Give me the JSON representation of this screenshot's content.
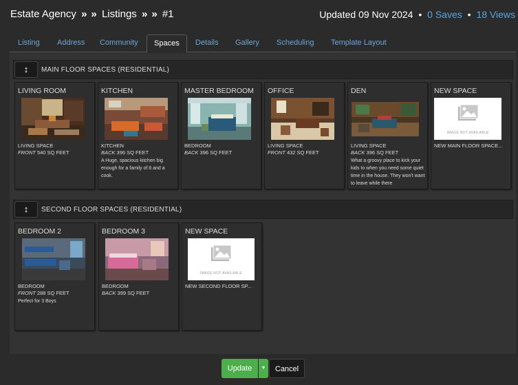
{
  "header": {
    "crumbs": [
      "Estate Agency",
      "Listings",
      "#1"
    ],
    "sep": "»",
    "updated": "Updated 09 Nov 2024",
    "saves": "0 Saves",
    "views": "18 Views",
    "dot": "•"
  },
  "tabs": [
    {
      "label": "Listing"
    },
    {
      "label": "Address"
    },
    {
      "label": "Community"
    },
    {
      "label": "Spaces",
      "active": true
    },
    {
      "label": "Details"
    },
    {
      "label": "Gallery"
    },
    {
      "label": "Scheduling"
    },
    {
      "label": "Template Layout"
    }
  ],
  "sections": [
    {
      "title": "MAIN FLOOR SPACES (RESIDENTIAL)",
      "toggle_icon": "↕",
      "cards": [
        {
          "title": "LIVING ROOM",
          "type": "LIVING SPACE",
          "position": "FRONT",
          "size": "540 SQ FEET",
          "desc": "",
          "image": "living-room"
        },
        {
          "title": "KITCHEN",
          "type": "KITCHEN",
          "position": "BACK",
          "size": "396 SQ FEET",
          "desc": "A Huge, spacious kitchen big enough for a family of 8 and a cook.",
          "image": "kitchen"
        },
        {
          "title": "MASTER BEDROOM",
          "type": "BEDROOM",
          "position": "BACK",
          "size": "396 SQ FEET",
          "desc": "",
          "image": "master-bedroom"
        },
        {
          "title": "OFFICE",
          "type": "LIVING SPACE",
          "position": "FRONT",
          "size": "432 SQ FEET",
          "desc": "",
          "image": "office"
        },
        {
          "title": "DEN",
          "type": "LIVING SPACE",
          "position": "BACK",
          "size": "396 SQ FEET",
          "desc": "What a groovy place to kick your kids to when you need some quiet time in the house. They won't want to leave while there",
          "image": "den"
        }
      ],
      "new_space": {
        "title": "NEW SPACE",
        "label": "NEW MAIN FLOOR SPACE...",
        "na_text": "IMAGE NOT AVAILABLE"
      }
    },
    {
      "title": "SECOND FLOOR SPACES (RESIDENTIAL)",
      "toggle_icon": "↕",
      "cards": [
        {
          "title": "BEDROOM 2",
          "type": "BEDROOM",
          "position": "FRONT",
          "size": "288 SQ FEET",
          "desc": "Perfect for 3 Boys",
          "image": "bedroom-2"
        },
        {
          "title": "BEDROOM 3",
          "type": "BEDROOM",
          "position": "BACK",
          "size": "399 SQ FEET",
          "desc": "",
          "image": "bedroom-3"
        }
      ],
      "new_space": {
        "title": "NEW SPACE",
        "label": "NEW SECOND FLOOR SP...",
        "na_text": "IMAGE NOT AVAILABLE"
      }
    }
  ],
  "actions": {
    "update": "Update",
    "caret": "▼",
    "cancel": "Cancel"
  },
  "colors": {
    "accent": "#5aa6e0",
    "update": "#4cae4c",
    "background": "#2b2b2b"
  }
}
